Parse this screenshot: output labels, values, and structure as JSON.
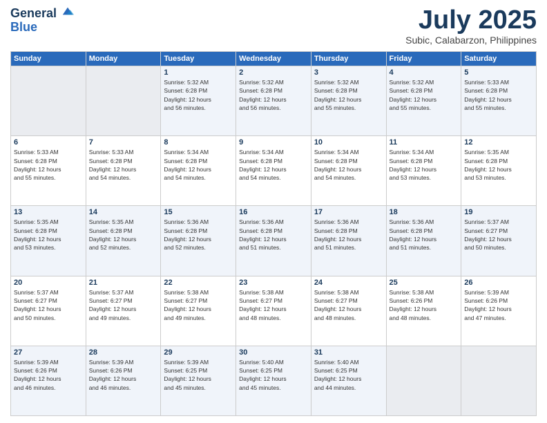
{
  "logo": {
    "line1": "General",
    "line2": "Blue"
  },
  "header": {
    "month_year": "July 2025",
    "location": "Subic, Calabarzon, Philippines"
  },
  "weekdays": [
    "Sunday",
    "Monday",
    "Tuesday",
    "Wednesday",
    "Thursday",
    "Friday",
    "Saturday"
  ],
  "weeks": [
    [
      {
        "day": "",
        "info": ""
      },
      {
        "day": "",
        "info": ""
      },
      {
        "day": "1",
        "info": "Sunrise: 5:32 AM\nSunset: 6:28 PM\nDaylight: 12 hours\nand 56 minutes."
      },
      {
        "day": "2",
        "info": "Sunrise: 5:32 AM\nSunset: 6:28 PM\nDaylight: 12 hours\nand 56 minutes."
      },
      {
        "day": "3",
        "info": "Sunrise: 5:32 AM\nSunset: 6:28 PM\nDaylight: 12 hours\nand 55 minutes."
      },
      {
        "day": "4",
        "info": "Sunrise: 5:32 AM\nSunset: 6:28 PM\nDaylight: 12 hours\nand 55 minutes."
      },
      {
        "day": "5",
        "info": "Sunrise: 5:33 AM\nSunset: 6:28 PM\nDaylight: 12 hours\nand 55 minutes."
      }
    ],
    [
      {
        "day": "6",
        "info": "Sunrise: 5:33 AM\nSunset: 6:28 PM\nDaylight: 12 hours\nand 55 minutes."
      },
      {
        "day": "7",
        "info": "Sunrise: 5:33 AM\nSunset: 6:28 PM\nDaylight: 12 hours\nand 54 minutes."
      },
      {
        "day": "8",
        "info": "Sunrise: 5:34 AM\nSunset: 6:28 PM\nDaylight: 12 hours\nand 54 minutes."
      },
      {
        "day": "9",
        "info": "Sunrise: 5:34 AM\nSunset: 6:28 PM\nDaylight: 12 hours\nand 54 minutes."
      },
      {
        "day": "10",
        "info": "Sunrise: 5:34 AM\nSunset: 6:28 PM\nDaylight: 12 hours\nand 54 minutes."
      },
      {
        "day": "11",
        "info": "Sunrise: 5:34 AM\nSunset: 6:28 PM\nDaylight: 12 hours\nand 53 minutes."
      },
      {
        "day": "12",
        "info": "Sunrise: 5:35 AM\nSunset: 6:28 PM\nDaylight: 12 hours\nand 53 minutes."
      }
    ],
    [
      {
        "day": "13",
        "info": "Sunrise: 5:35 AM\nSunset: 6:28 PM\nDaylight: 12 hours\nand 53 minutes."
      },
      {
        "day": "14",
        "info": "Sunrise: 5:35 AM\nSunset: 6:28 PM\nDaylight: 12 hours\nand 52 minutes."
      },
      {
        "day": "15",
        "info": "Sunrise: 5:36 AM\nSunset: 6:28 PM\nDaylight: 12 hours\nand 52 minutes."
      },
      {
        "day": "16",
        "info": "Sunrise: 5:36 AM\nSunset: 6:28 PM\nDaylight: 12 hours\nand 51 minutes."
      },
      {
        "day": "17",
        "info": "Sunrise: 5:36 AM\nSunset: 6:28 PM\nDaylight: 12 hours\nand 51 minutes."
      },
      {
        "day": "18",
        "info": "Sunrise: 5:36 AM\nSunset: 6:28 PM\nDaylight: 12 hours\nand 51 minutes."
      },
      {
        "day": "19",
        "info": "Sunrise: 5:37 AM\nSunset: 6:27 PM\nDaylight: 12 hours\nand 50 minutes."
      }
    ],
    [
      {
        "day": "20",
        "info": "Sunrise: 5:37 AM\nSunset: 6:27 PM\nDaylight: 12 hours\nand 50 minutes."
      },
      {
        "day": "21",
        "info": "Sunrise: 5:37 AM\nSunset: 6:27 PM\nDaylight: 12 hours\nand 49 minutes."
      },
      {
        "day": "22",
        "info": "Sunrise: 5:38 AM\nSunset: 6:27 PM\nDaylight: 12 hours\nand 49 minutes."
      },
      {
        "day": "23",
        "info": "Sunrise: 5:38 AM\nSunset: 6:27 PM\nDaylight: 12 hours\nand 48 minutes."
      },
      {
        "day": "24",
        "info": "Sunrise: 5:38 AM\nSunset: 6:27 PM\nDaylight: 12 hours\nand 48 minutes."
      },
      {
        "day": "25",
        "info": "Sunrise: 5:38 AM\nSunset: 6:26 PM\nDaylight: 12 hours\nand 48 minutes."
      },
      {
        "day": "26",
        "info": "Sunrise: 5:39 AM\nSunset: 6:26 PM\nDaylight: 12 hours\nand 47 minutes."
      }
    ],
    [
      {
        "day": "27",
        "info": "Sunrise: 5:39 AM\nSunset: 6:26 PM\nDaylight: 12 hours\nand 46 minutes."
      },
      {
        "day": "28",
        "info": "Sunrise: 5:39 AM\nSunset: 6:26 PM\nDaylight: 12 hours\nand 46 minutes."
      },
      {
        "day": "29",
        "info": "Sunrise: 5:39 AM\nSunset: 6:25 PM\nDaylight: 12 hours\nand 45 minutes."
      },
      {
        "day": "30",
        "info": "Sunrise: 5:40 AM\nSunset: 6:25 PM\nDaylight: 12 hours\nand 45 minutes."
      },
      {
        "day": "31",
        "info": "Sunrise: 5:40 AM\nSunset: 6:25 PM\nDaylight: 12 hours\nand 44 minutes."
      },
      {
        "day": "",
        "info": ""
      },
      {
        "day": "",
        "info": ""
      }
    ]
  ]
}
